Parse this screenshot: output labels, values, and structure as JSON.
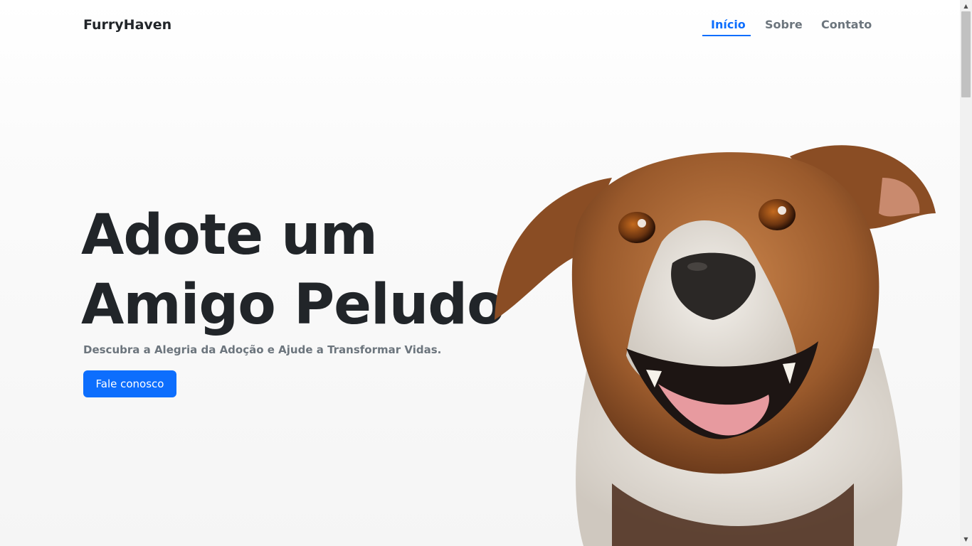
{
  "navbar": {
    "brand": "FurryHaven",
    "links": [
      {
        "label": "Início",
        "active": true
      },
      {
        "label": "Sobre",
        "active": false
      },
      {
        "label": "Contato",
        "active": false
      }
    ]
  },
  "hero": {
    "title_line1": "Adote um",
    "title_line2": "Amigo Peludo",
    "subtitle": "Descubra a Alegria da Adoção e Ajude a Transformar Vidas.",
    "cta_label": "Fale conosco"
  },
  "image": {
    "subject": "smiling-brown-white-dog"
  },
  "colors": {
    "accent": "#0d6efd",
    "text_dark": "#212529",
    "text_muted": "#6c757d"
  }
}
